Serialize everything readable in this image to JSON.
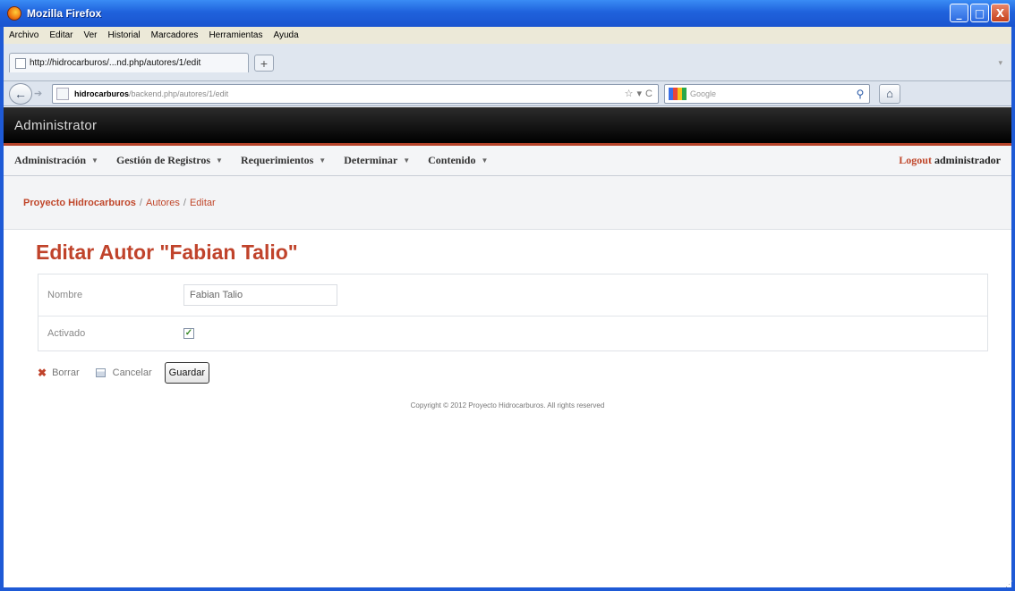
{
  "window": {
    "title": "Mozilla Firefox",
    "controls": {
      "minimize": "_",
      "maximize": "□",
      "close": "X"
    }
  },
  "menubar": [
    "Archivo",
    "Editar",
    "Ver",
    "Historial",
    "Marcadores",
    "Herramientas",
    "Ayuda"
  ],
  "tab": {
    "title": "http://hidrocarburos/...nd.php/autores/1/edit",
    "newtab": "+"
  },
  "navbar": {
    "url_host": "hidrocarburos",
    "url_path": "/backend.php/autores/1/edit",
    "search_placeholder": "Google",
    "bookmark_icon": "☆",
    "dropdown_icon": "▾",
    "reload_icon": "C"
  },
  "site": {
    "header": "Administrator",
    "nav": [
      {
        "label": "Administración"
      },
      {
        "label": "Gestión de Registros"
      },
      {
        "label": "Requerimientos"
      },
      {
        "label": "Determinar"
      },
      {
        "label": "Contenido"
      }
    ],
    "logout_label": "Logout",
    "user": "administrador",
    "breadcrumb": [
      "Proyecto Hidrocarburos",
      "Autores",
      "Editar"
    ]
  },
  "form": {
    "title": "Editar Autor \"Fabian Talio\"",
    "fields": {
      "nombre_label": "Nombre",
      "nombre_value": "Fabian Talio",
      "activado_label": "Activado",
      "activado_checked": true
    },
    "actions": {
      "delete": "Borrar",
      "cancel": "Cancelar",
      "save": "Guardar"
    }
  },
  "footer": "Copyright © 2012 Proyecto Hidrocarburos. All rights reserved",
  "colors": {
    "accent": "#c0432b",
    "titlebar": "#1f62dc",
    "header": "#000000"
  }
}
